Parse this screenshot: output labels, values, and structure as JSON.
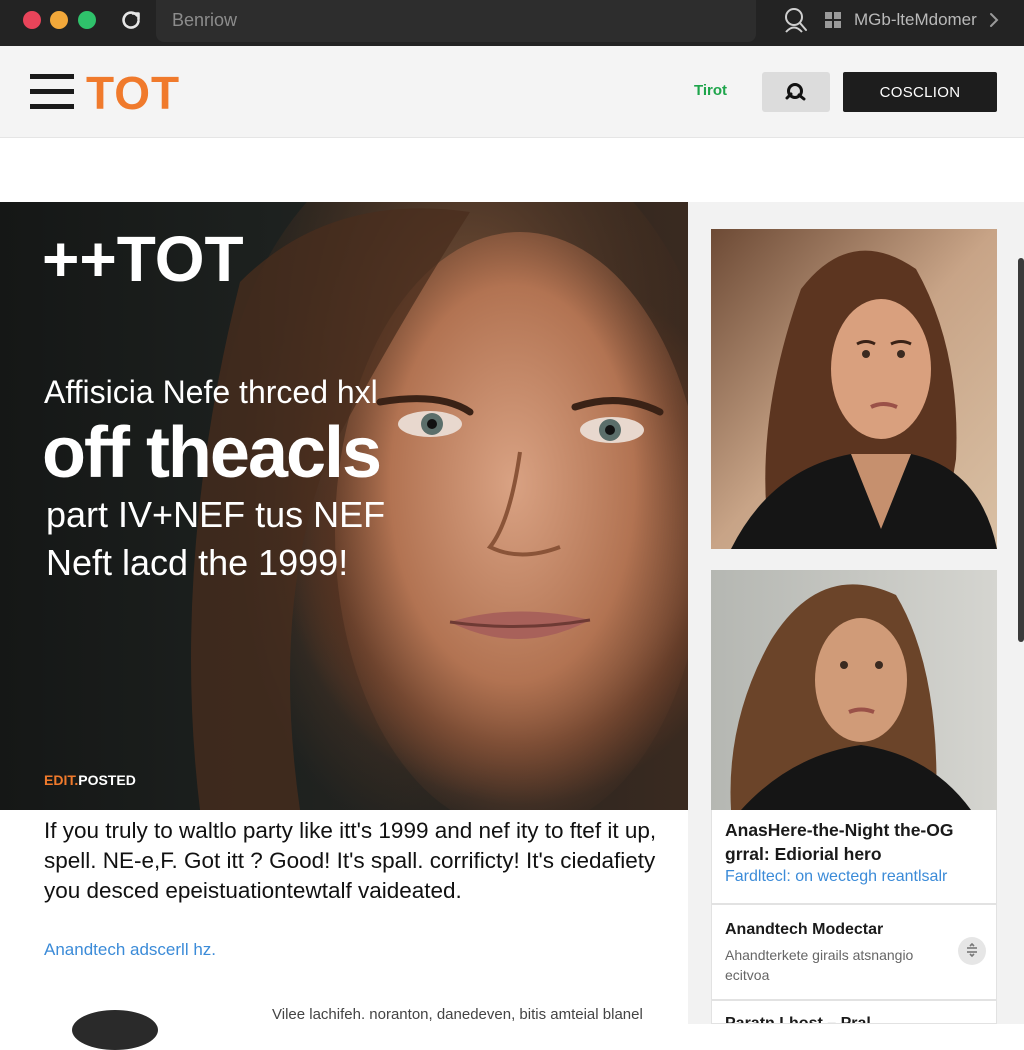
{
  "browser": {
    "url_text": "Benriow",
    "account_label": "MGb-lteMdomer"
  },
  "header": {
    "logo": "TOT",
    "nav_link": "Tirot",
    "cta_label": "COSCLION"
  },
  "hero": {
    "brand": "++TOT",
    "kicker": "Affisicia Nefe thrced hxl",
    "title": "off theacls",
    "subtitle_line1": "part IV+NEF tus NEF",
    "subtitle_line2": "Neft lacd the 1999!",
    "tag_accent": "EDIT.",
    "tag_label": "POSTED"
  },
  "article": {
    "body": "If you truly to waltlo party like itt's 1999 and nef ity to ftef it up, spell. NE-e,F. Got itt ? Good! It's spall. corrificty! It's ciedafiety you desced epeistuationtewtalf vaideated.",
    "link": "Anandtech adscerll hz.",
    "bottom_text": "Vilee lachifeh. noranton, danedeven, bitis amteial blanel"
  },
  "sidebar": {
    "card1_title": "AnasHere-the-Night the-OG grral: Ediorial hero",
    "card1_meta": "Fardltecl: on wectegh reantlsalr",
    "card2_title": "Anandtech Modectar",
    "card2_desc": "Ahandterkete girails atsnangio ecitvoa",
    "card3_title": "Paratn Lhost – Pral"
  }
}
